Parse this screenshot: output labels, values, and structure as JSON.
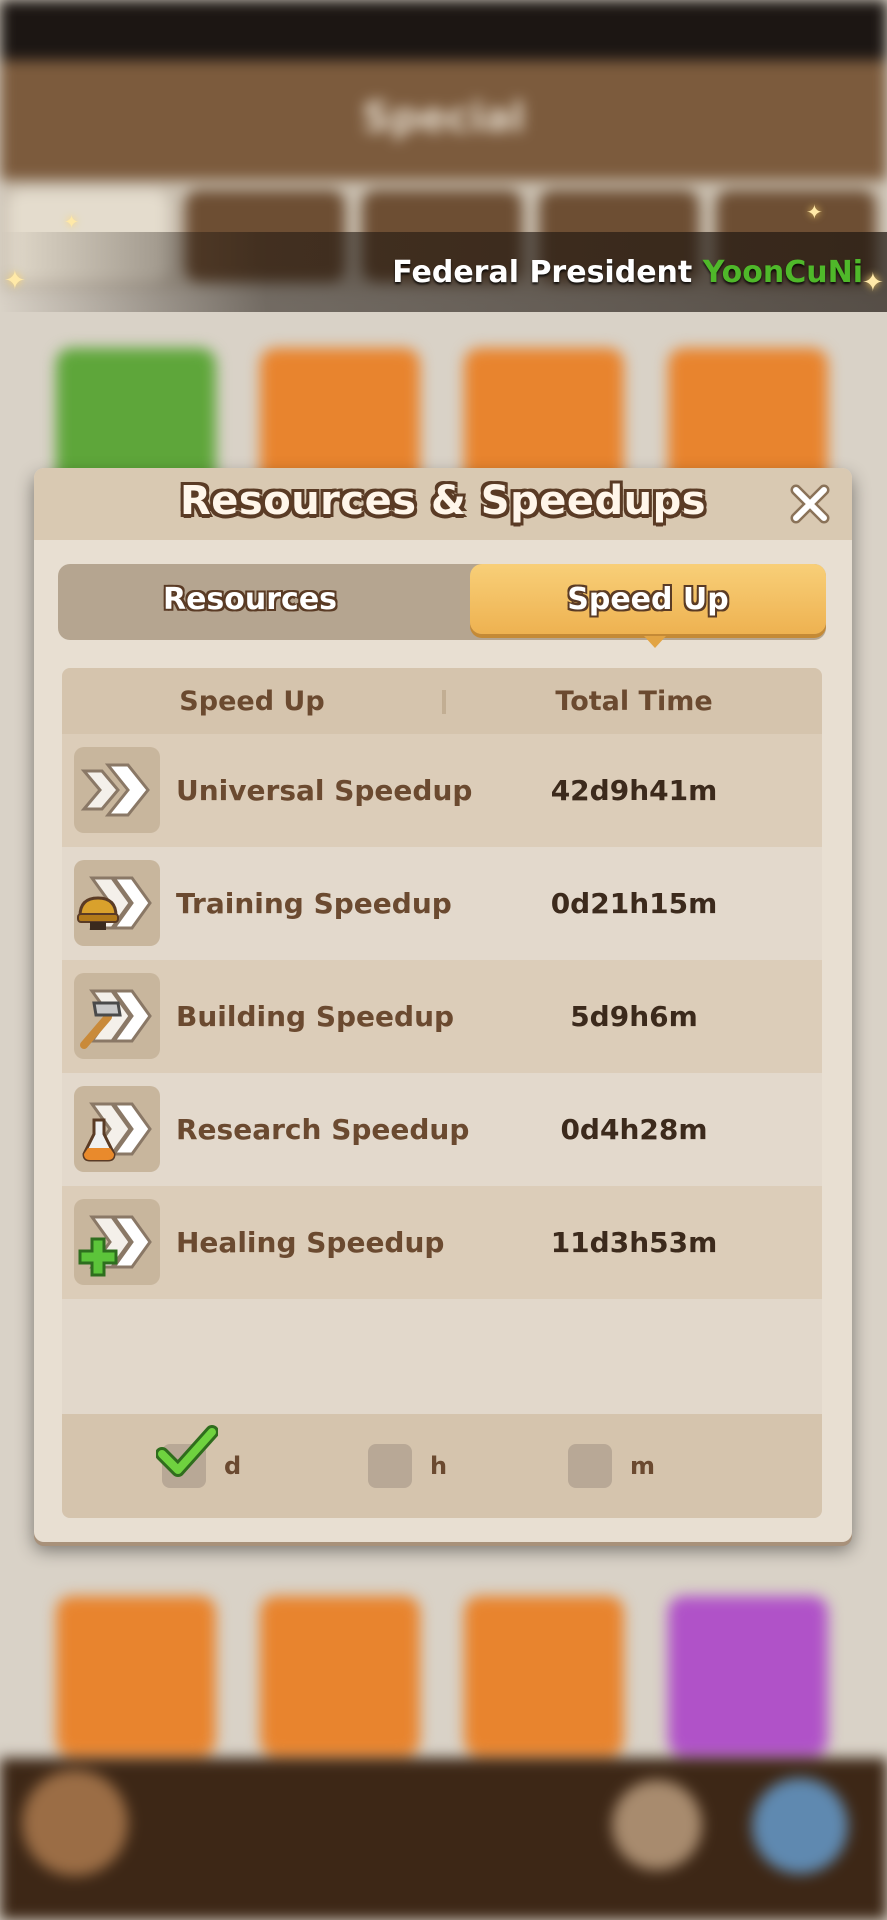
{
  "background": {
    "header_title": "Special"
  },
  "banner": {
    "prefix": "Federal President ",
    "name": "YoonCuNi"
  },
  "modal": {
    "title": "Resources & Speedups",
    "tabs": {
      "resources": "Resources",
      "speedup": "Speed Up"
    },
    "columns": {
      "type": "Speed Up",
      "total": "Total Time"
    },
    "rows": [
      {
        "icon": "universal-speedup-icon",
        "name": "Universal Speedup",
        "time": "42d9h41m"
      },
      {
        "icon": "training-speedup-icon",
        "name": "Training Speedup",
        "time": "0d21h15m"
      },
      {
        "icon": "building-speedup-icon",
        "name": "Building Speedup",
        "time": "5d9h6m"
      },
      {
        "icon": "research-speedup-icon",
        "name": "Research Speedup",
        "time": "0d4h28m"
      },
      {
        "icon": "healing-speedup-icon",
        "name": "Healing Speedup",
        "time": "11d3h53m"
      }
    ],
    "units": [
      {
        "label": "d",
        "checked": true
      },
      {
        "label": "h",
        "checked": false
      },
      {
        "label": "m",
        "checked": false
      }
    ]
  },
  "colors": {
    "accent_tab": "#f2bd5e",
    "name_green": "#4fb82a",
    "text_brown": "#6b4a30"
  }
}
